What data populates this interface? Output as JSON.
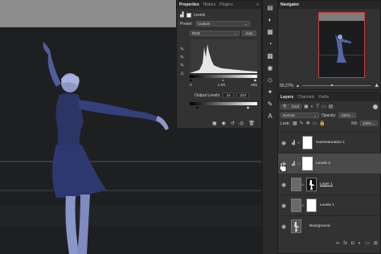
{
  "properties": {
    "tabs": [
      "Properties",
      "History",
      "Plugins"
    ],
    "panel_title": "Levels",
    "preset_label": "Preset:",
    "preset_value": "Custom",
    "channel_value": "RGB",
    "auto_label": "Auto",
    "input_levels": [
      "0",
      "1.00",
      "255"
    ],
    "output_label": "Output Levels:",
    "output_levels": [
      "24",
      "223"
    ]
  },
  "navigator": {
    "tab": "Navigator",
    "zoom": "55.27%"
  },
  "layers_panel": {
    "tabs": [
      "Layers",
      "Channels",
      "Paths"
    ],
    "kind_label": "Kind",
    "blend_mode": "Normal",
    "opacity_label": "Opacity:",
    "opacity_value": "100%",
    "lock_label": "Lock:",
    "fill_label": "Fill:",
    "fill_value": "100%",
    "layers": [
      {
        "name": "Hue/Saturation 1"
      },
      {
        "name": "Levels 2"
      },
      {
        "name": "Layer 1"
      },
      {
        "name": "Levels 1"
      },
      {
        "name": "Background"
      }
    ]
  },
  "colors": {
    "accent": "#2f6fd6",
    "figure": "#4b5a96",
    "panel": "#323232"
  }
}
